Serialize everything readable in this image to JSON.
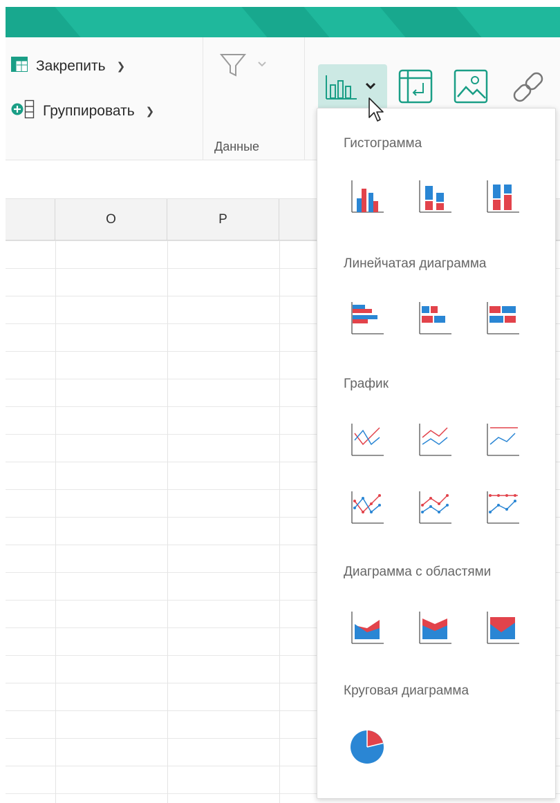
{
  "ribbon": {
    "freeze_label": "Закрепить",
    "group_label": "Группировать",
    "data_group_label": "Данные"
  },
  "sheet": {
    "columns": [
      "O",
      "P"
    ]
  },
  "chart_menu": {
    "sections": {
      "histogram": "Гистограмма",
      "bar": "Линейчатая диаграмма",
      "line": "График",
      "area": "Диаграмма с областями",
      "pie": "Круговая диаграмма"
    }
  },
  "colors": {
    "accent_green": "#1fb89c",
    "chart_red": "#e2434b",
    "chart_blue": "#2a86d4",
    "active_button_bg": "#cce9e4"
  }
}
